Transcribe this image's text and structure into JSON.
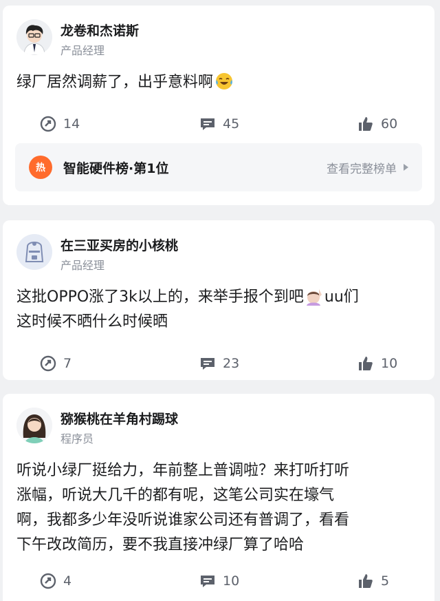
{
  "posts": [
    {
      "username": "龙卷和杰诺斯",
      "role": "产品经理",
      "text": "绿厂居然调薪了，出乎意料啊",
      "emoji": "laughing-crying-emoji",
      "shares": "14",
      "comments": "45",
      "likes": "60",
      "rank": {
        "badge": "热",
        "title": "智能硬件榜·第1位",
        "link": "查看完整榜单"
      }
    },
    {
      "username": "在三亚买房的小核桃",
      "role": "产品经理",
      "text": "这批OPPO涨了3k以上的，来举手报个到吧",
      "text_tail": "uu们\n这时候不晒什么时候晒",
      "emoji": "raising-hand-emoji",
      "shares": "7",
      "comments": "23",
      "likes": "10"
    },
    {
      "username": "猕猴桃在羊角村踢球",
      "role": "程序员",
      "text": "听说小绿厂挺给力，年前整上普调啦？来打听打听\n涨幅，听说大几千的都有呢，这笔公司实在壕气\n啊，我都多少年没听说谁家公司还有普调了，看看\n下午改改简历，要不我直接冲绿厂算了哈哈",
      "shares": "4",
      "comments": "10",
      "likes": "5"
    }
  ],
  "colors": {
    "background": "#f0f1f3",
    "card": "#ffffff",
    "accent_fire": "#ff6b2c",
    "muted_text": "#8a8f99"
  },
  "icons": [
    "share-icon",
    "comment-icon",
    "like-icon",
    "fire-icon",
    "chevron-right-icon"
  ]
}
